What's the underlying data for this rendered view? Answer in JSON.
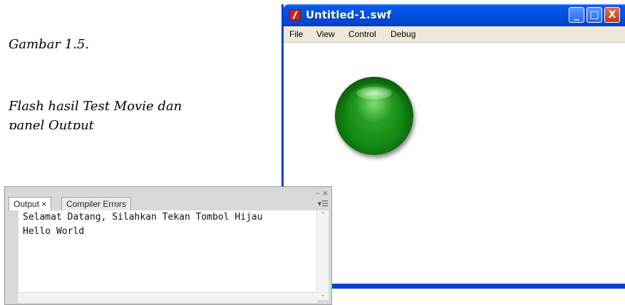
{
  "caption": {
    "line1": "Gambar 1.5.",
    "line2": "Flash hasil Test Movie dan",
    "line3": "panel Output"
  },
  "flash_window": {
    "title": "Untitled-1.swf",
    "controls": {
      "minimize": "_",
      "maximize": "□",
      "close": "X"
    },
    "menu": [
      "File",
      "View",
      "Control",
      "Debug"
    ]
  },
  "output_panel": {
    "tabs": [
      "Output ×",
      "Compiler Errors"
    ],
    "window_controls": "– ×",
    "menu_icon": "▾☰",
    "lines": [
      "Selamat Datang, Silahkan Tekan Tombol Hijau",
      "Hello World"
    ]
  },
  "colors": {
    "titlebar": "#0054e3",
    "button_green": "#138a13"
  }
}
